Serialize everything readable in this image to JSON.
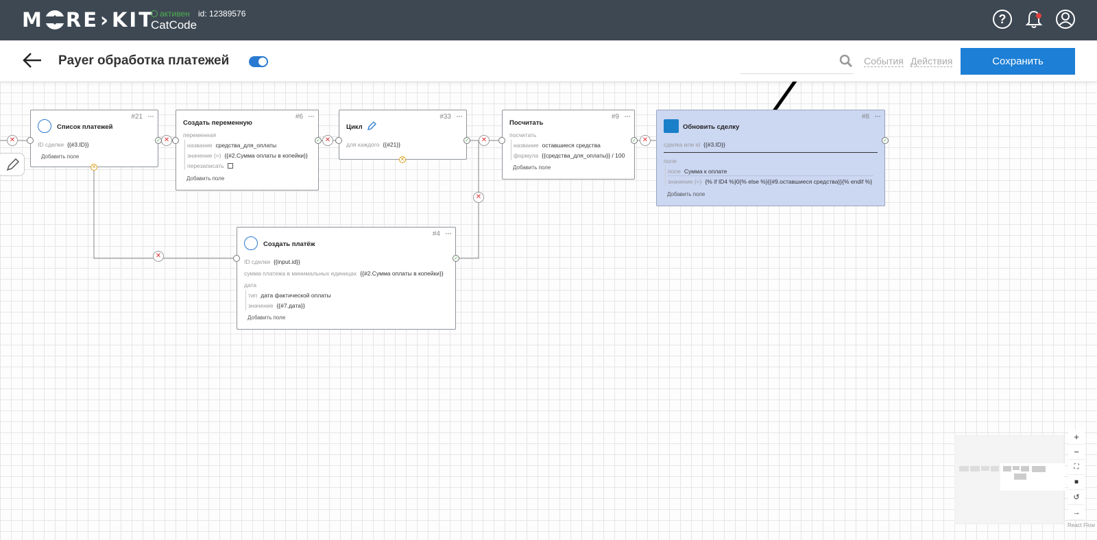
{
  "app": {
    "logo": "MORE>KIT",
    "status": "активен",
    "id_label": "id: 12389576",
    "name": "CatCode"
  },
  "topbar_icons": [
    "help-icon",
    "bell-icon",
    "user-icon"
  ],
  "header": {
    "title": "Payer обработка платежей",
    "events_link": "События",
    "actions_link": "Действия",
    "save_label": "Сохранить",
    "toggle_on": true
  },
  "nodes": {
    "n21": {
      "title": "Список платежей",
      "num": "#21",
      "dots": "···",
      "row1_label": "ID сделки",
      "row1_value": "{{#3.ID}}",
      "add": "Добавить поле"
    },
    "n6": {
      "title": "Создать переменную",
      "num": "#6",
      "dots": "···",
      "group": "переменная",
      "r1l": "название",
      "r1v": "средства_для_оплаты",
      "r2l": "значение (=)",
      "r2v": "{{#2.Сумма оплаты в копейки}}",
      "r3l": "перезаписать",
      "add": "Добавить поле"
    },
    "n33": {
      "title": "Цикл",
      "num": "#33",
      "dots": "···",
      "r1l": "для каждого",
      "r1v": "{{#21}}"
    },
    "n9": {
      "title": "Посчитать",
      "num": "#9",
      "dots": "···",
      "group": "посчитать",
      "r1l": "название",
      "r1v": "оставшиеся средства",
      "r2l": "формула",
      "r2v": "{{средства_для_оплаты}} / 100",
      "add": "Добавить поле"
    },
    "n8": {
      "title": "Обновить сделку",
      "num": "#8",
      "dots": "···",
      "r1l": "сделка или id",
      "r1v": "{{#3.ID}}",
      "group": "поле",
      "r2l": "поле",
      "r2v": "Сумма к оплате",
      "r3l": "значение (=)",
      "r3v": "{% if ID4 %}0{% else %}{{#9.оставшиеся средства}}{% endif %}",
      "add": "Добавить поле"
    },
    "n4": {
      "title": "Создать платёж",
      "num": "#4",
      "dots": "···",
      "r1l": "ID сделки",
      "r1v": "{{input.id}}",
      "r2l": "сумма платежа в минимальных единицах",
      "r2v": "{{#2.Сумма оплаты в копейки}}",
      "group": "дата",
      "r3l": "тип",
      "r3v": "дата фактической оплаты",
      "r4l": "значение",
      "r4v": "{{#7.дата}}",
      "add": "Добавить поле"
    }
  },
  "controls": [
    "zoom-in",
    "zoom-out",
    "fit-view",
    "lock",
    "reset",
    "next"
  ],
  "react_flow": "React Flow"
}
